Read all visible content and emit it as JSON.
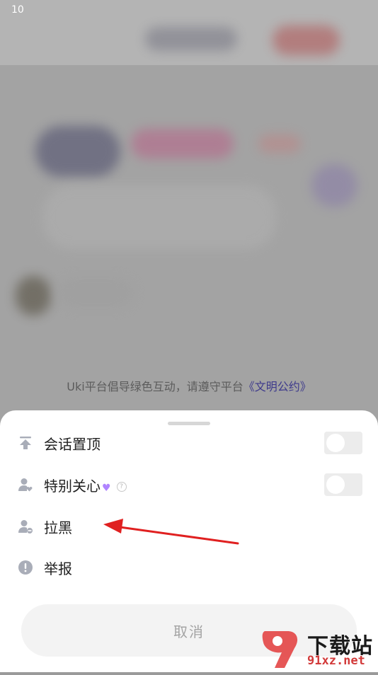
{
  "status_bar": {
    "time": "10"
  },
  "background": {
    "notice_text": "Uki平台倡导绿色互动，请遵守平台",
    "notice_link": "《文明公约》"
  },
  "sheet": {
    "items": [
      {
        "label": "会话置顶",
        "icon": "pin-top-icon",
        "has_toggle": true,
        "toggle_on": false
      },
      {
        "label": "特别关心",
        "icon": "person-heart-icon",
        "has_toggle": true,
        "toggle_on": false
      },
      {
        "label": "拉黑",
        "icon": "person-block-icon",
        "has_toggle": false
      },
      {
        "label": "举报",
        "icon": "alert-circle-icon",
        "has_toggle": false
      }
    ],
    "cancel_label": "取消"
  },
  "watermark": {
    "title": "下载站",
    "domain": "91xz.net"
  },
  "colors": {
    "accent_purple": "#b084ff",
    "link": "#3e3a8c",
    "annotation_red": "#e02020"
  }
}
